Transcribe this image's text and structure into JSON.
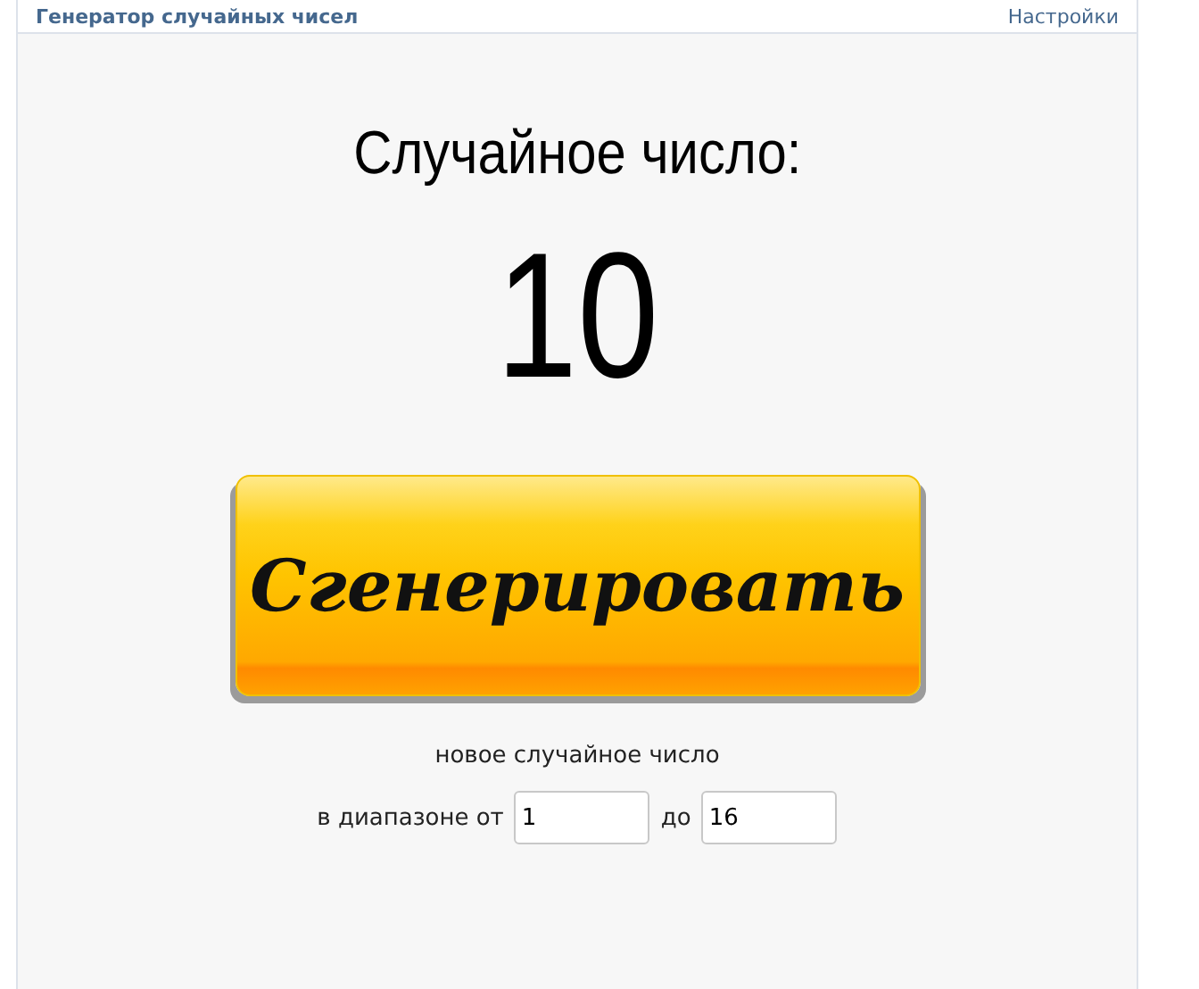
{
  "header": {
    "title": "Генератор случайных чисел",
    "settings_link": "Настройки"
  },
  "result": {
    "label": "Случайное число:",
    "value": "10"
  },
  "generate_button": "Сгенерировать",
  "caption": "новое случайное число",
  "range": {
    "from_label": "в диапазоне от",
    "from_value": "1",
    "to_label": "до",
    "to_value": "16"
  }
}
